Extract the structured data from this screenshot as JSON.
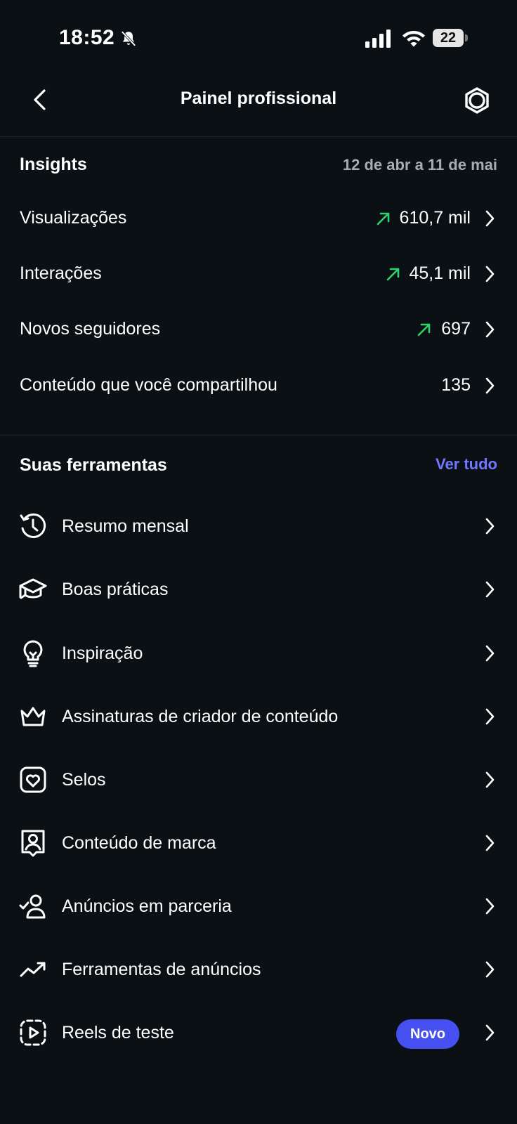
{
  "status_bar": {
    "time": "18:52",
    "battery": "22",
    "icons": [
      "bell-slash-icon",
      "signal-icon",
      "wifi-icon",
      "battery-icon"
    ]
  },
  "header": {
    "title": "Painel profissional",
    "back_icon": "chevron-left-icon",
    "settings_icon": "gear-icon"
  },
  "insights": {
    "heading": "Insights",
    "date_range": "12 de abr a 11 de mai",
    "metrics": [
      {
        "label": "Visualizações",
        "value": "610,7 mil",
        "trend": "up"
      },
      {
        "label": "Interações",
        "value": "45,1 mil",
        "trend": "up"
      },
      {
        "label": "Novos seguidores",
        "value": "697",
        "trend": "up"
      },
      {
        "label": "Conteúdo que você compartilhou",
        "value": "135",
        "trend": "none"
      }
    ]
  },
  "tools": {
    "heading": "Suas ferramentas",
    "see_all": "Ver tudo",
    "items": [
      {
        "label": "Resumo mensal",
        "icon": "history-icon"
      },
      {
        "label": "Boas práticas",
        "icon": "graduation-cap-icon"
      },
      {
        "label": "Inspiração",
        "icon": "lightbulb-icon"
      },
      {
        "label": "Assinaturas de criador de conteúdo",
        "icon": "crown-icon"
      },
      {
        "label": "Selos",
        "icon": "heart-badge-icon"
      },
      {
        "label": "Conteúdo de marca",
        "icon": "branded-content-icon"
      },
      {
        "label": "Anúncios em parceria",
        "icon": "partner-ads-icon"
      },
      {
        "label": "Ferramentas de anúncios",
        "icon": "trending-up-icon"
      },
      {
        "label": "Reels de teste",
        "icon": "reels-test-icon",
        "badge": "Novo"
      }
    ]
  },
  "colors": {
    "background": "#0b1014",
    "accent": "#6f78ff",
    "trend_up": "#2fd36b",
    "badge": "#4650f0",
    "muted_text": "#a8adb2"
  }
}
